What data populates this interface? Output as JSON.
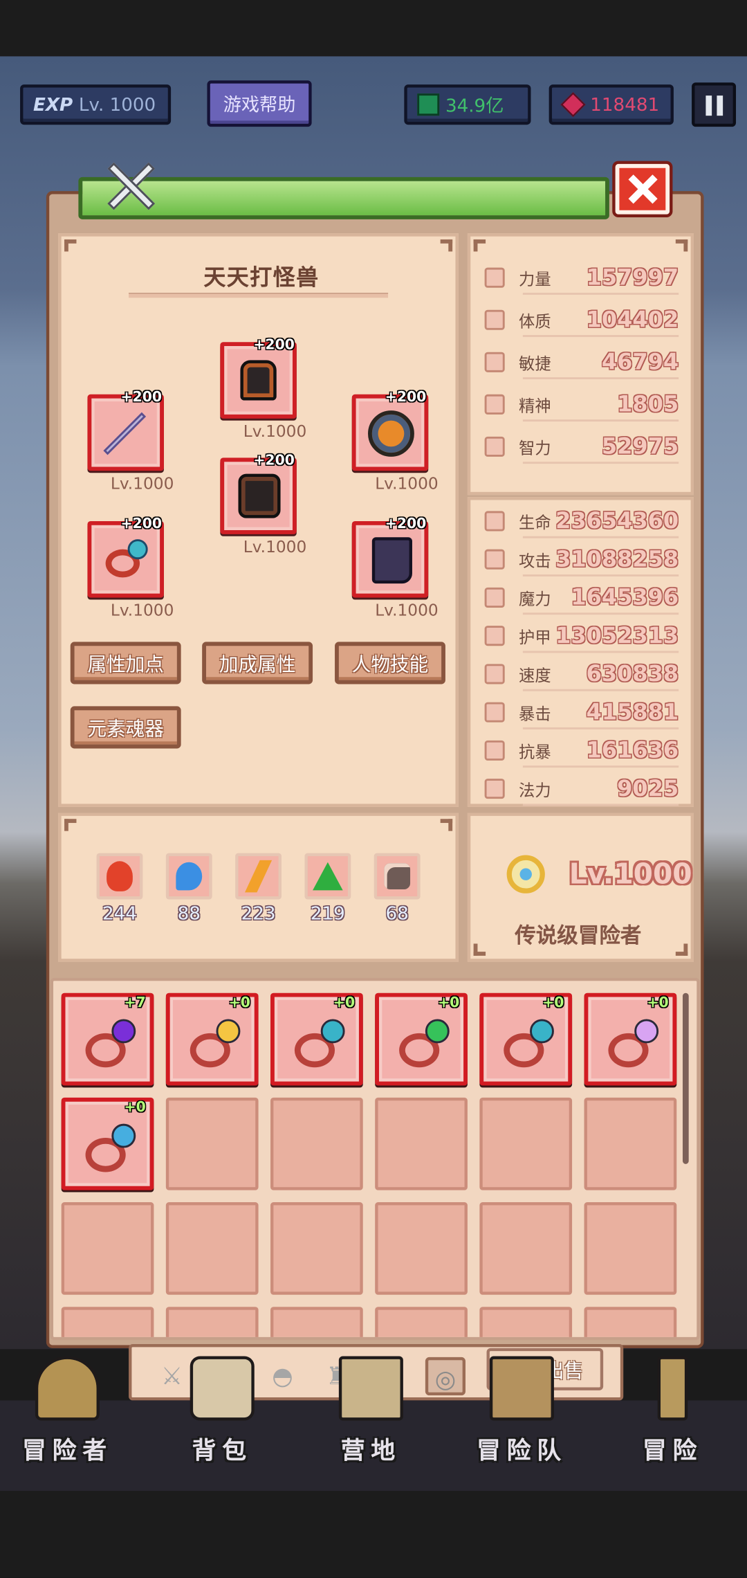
{
  "hud": {
    "exp_label": "EXP",
    "level": "Lv. 1000",
    "help_button": "游戏帮助",
    "gem_green": "34.9亿",
    "gem_red": "118481"
  },
  "panel": {
    "title": "天天打怪兽",
    "equipment": [
      {
        "slot": "helmet",
        "plus": "+200",
        "level": "Lv.1000"
      },
      {
        "slot": "weapon",
        "plus": "+200",
        "level": "Lv.1000"
      },
      {
        "slot": "armor",
        "plus": "+200",
        "level": "Lv.1000"
      },
      {
        "slot": "accessory",
        "plus": "+200",
        "level": "Lv.1000"
      },
      {
        "slot": "ring",
        "plus": "+200",
        "level": "Lv.1000"
      },
      {
        "slot": "boots",
        "plus": "+200",
        "level": "Lv.1000"
      }
    ],
    "buttons": {
      "attr_points": "属性加点",
      "bonus_attr": "加成属性",
      "char_skills": "人物技能",
      "element_soul": "元素魂器"
    },
    "elements": [
      {
        "name": "fire",
        "value": "244",
        "color": "#e2422a"
      },
      {
        "name": "water",
        "value": "88",
        "color": "#3b8fe3"
      },
      {
        "name": "thunder",
        "value": "223",
        "color": "#f2a12b"
      },
      {
        "name": "earth",
        "value": "219",
        "color": "#2fae3f"
      },
      {
        "name": "dark",
        "value": "68",
        "color": "#6f5b56"
      }
    ]
  },
  "stats": {
    "primary": [
      {
        "label": "力量",
        "value": "157997"
      },
      {
        "label": "体质",
        "value": "104402"
      },
      {
        "label": "敏捷",
        "value": "46794"
      },
      {
        "label": "精神",
        "value": "1805"
      },
      {
        "label": "智力",
        "value": "52975"
      }
    ],
    "secondary": [
      {
        "label": "生命",
        "value": "23654360"
      },
      {
        "label": "攻击",
        "value": "31088258"
      },
      {
        "label": "魔力",
        "value": "1645396"
      },
      {
        "label": "护甲",
        "value": "13052313"
      },
      {
        "label": "速度",
        "value": "630838"
      },
      {
        "label": "暴击",
        "value": "415881"
      },
      {
        "label": "抗暴",
        "value": "161636"
      },
      {
        "label": "法力",
        "value": "9025"
      }
    ],
    "rank_level": "Lv.1000",
    "rank_title": "传说级冒险者"
  },
  "inventory": [
    {
      "plus": "+7",
      "gem": "#7a2fd8"
    },
    {
      "plus": "+0",
      "gem": "#f4c542"
    },
    {
      "plus": "+0",
      "gem": "#39b3c8"
    },
    {
      "plus": "+0",
      "gem": "#36c25a"
    },
    {
      "plus": "+0",
      "gem": "#39b3c8"
    },
    {
      "plus": "+0",
      "gem": "#d8a4f2"
    },
    {
      "plus": "+0",
      "gem": "#46aee0"
    }
  ],
  "bag_tabs": {
    "sell_button": "批量出售"
  },
  "nav": {
    "adventurer": "冒险者",
    "bag": "背包",
    "camp": "营地",
    "party": "冒险队",
    "adventure": "冒险"
  }
}
